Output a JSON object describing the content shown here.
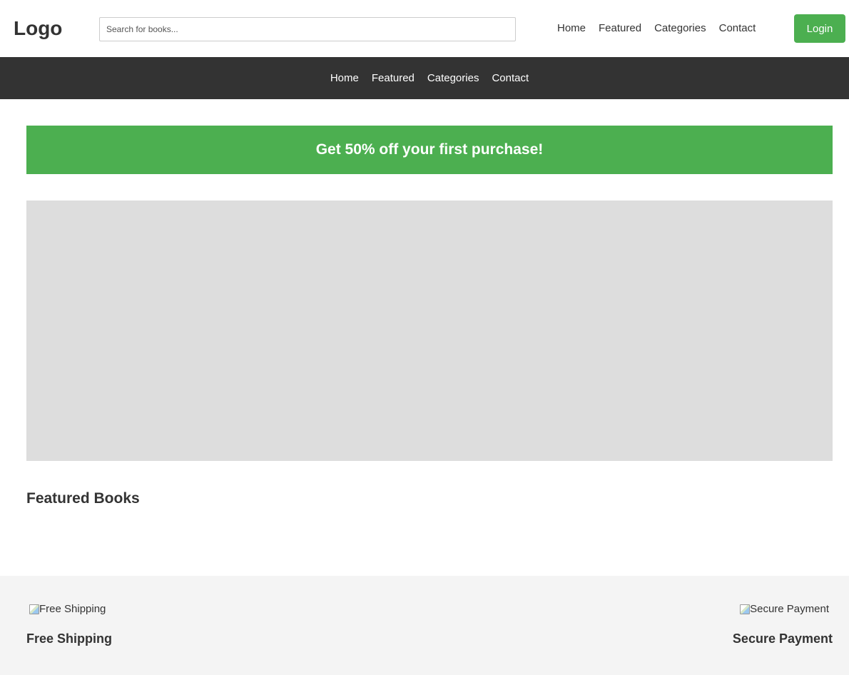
{
  "header": {
    "logo": "Logo",
    "search_placeholder": "Search for books...",
    "search_value": "",
    "nav": [
      "Home",
      "Featured",
      "Categories",
      "Contact"
    ],
    "login_label": "Login"
  },
  "subnav": {
    "items": [
      "Home",
      "Featured",
      "Categories",
      "Contact"
    ]
  },
  "promo": {
    "text": "Get 50% off your first purchase!"
  },
  "main": {
    "section_title": "Featured Books"
  },
  "footer": {
    "features": [
      {
        "image_alt": "Free Shipping",
        "title": "Free Shipping"
      },
      {
        "image_alt": "Secure Payment",
        "title": "Secure Payment"
      }
    ]
  },
  "colors": {
    "accent": "#4caf50",
    "dark_bar": "#333333",
    "hero_placeholder": "#dddddd",
    "footer_bg": "#f4f4f4"
  },
  "icons": [
    "broken-image-icon"
  ]
}
